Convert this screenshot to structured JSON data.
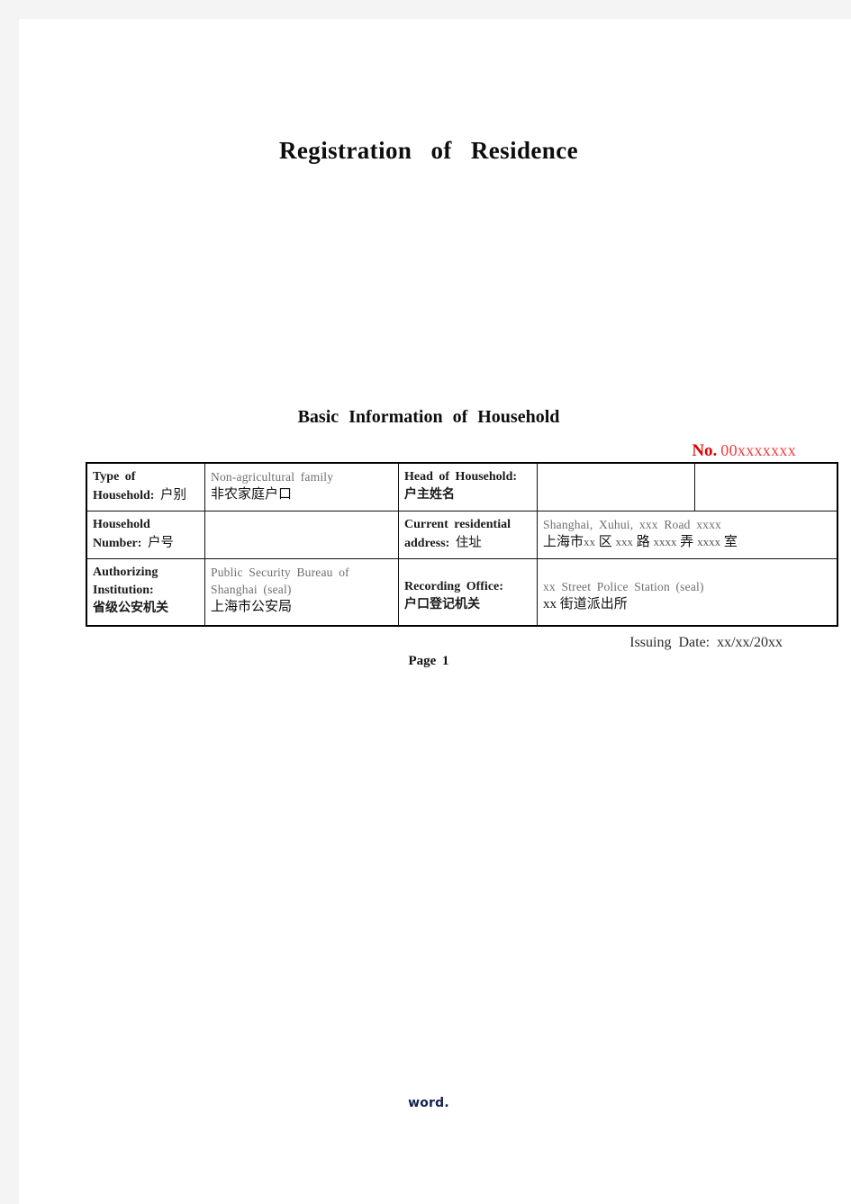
{
  "document": {
    "title": "Registration    of    Residence",
    "section_title": "Basic  Information  of  Household",
    "serial": {
      "label": "No.",
      "value": "00xxxxxxx",
      "label_color": "#e00000",
      "value_color": "#f23c3c"
    },
    "issuing_date": "Issuing  Date:  xx/xx/20xx",
    "page_number": "Page  1",
    "watermark": "word."
  },
  "table": {
    "rows": [
      {
        "label_en": "Type of",
        "label_en2": "Household:",
        "label_cn": "户别",
        "value_en": "Non-agricultural  family",
        "value_cn": "非农家庭户口",
        "label2_en": "Head  of  Household:",
        "label2_cn": "户主姓名",
        "value2_en": "",
        "value2_cn": "",
        "value3": ""
      },
      {
        "label_en": "Household",
        "label_en2": "Number:",
        "label_cn": "户号",
        "value_en": "",
        "value_cn": "",
        "label2_en": "Current  residential",
        "label2_en2": "address:",
        "label2_cn": "住址",
        "value2_en": "Shanghai,  Xuhui,  xxx  Road  xxxx",
        "value2_cn_prefix": "上海市",
        "value2_cn_parts": [
          "xx",
          "区",
          "xxx",
          "路",
          "xxxx",
          "弄",
          "xxxx",
          "室"
        ]
      },
      {
        "label_en": "Authorizing",
        "label_en2": "Institution:",
        "label_cn": "省级公安机关",
        "value_en_line1": "Public  Security  Bureau  of",
        "value_en_line2": "Shanghai  (seal)",
        "value_cn": "上海市公安局",
        "label2_en": "Recording  Office:",
        "label2_cn": "户口登记机关",
        "value2_en": "xx  Street  Police  Station  (seal)",
        "value2_cn": "xx 街道派出所"
      }
    ]
  }
}
